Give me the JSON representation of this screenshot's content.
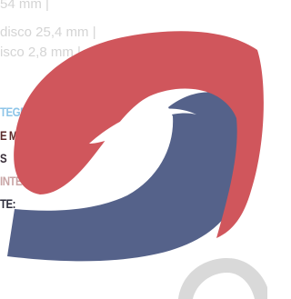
{
  "spec_lines": [
    "54 mm |",
    "disco 25,4 mm |",
    "isco 2,8 mm |"
  ],
  "features": [
    {
      "text": "TEGRADO",
      "color": "#8ec5e8"
    },
    {
      "text": "E MESA INCLUIDO",
      "color": "#5b2a2a"
    },
    {
      "text": "S",
      "color": "#3a2f3a"
    },
    {
      "text": "INTEGRADA",
      "color": "#c9a5a5"
    },
    {
      "text": "TE:",
      "color": "#2b2b3a"
    }
  ],
  "colors": {
    "logo_red": "#d0565c",
    "logo_blue": "#55628a",
    "ring_gray": "#d9d9d9",
    "spec_text": "#d4d4d4"
  }
}
